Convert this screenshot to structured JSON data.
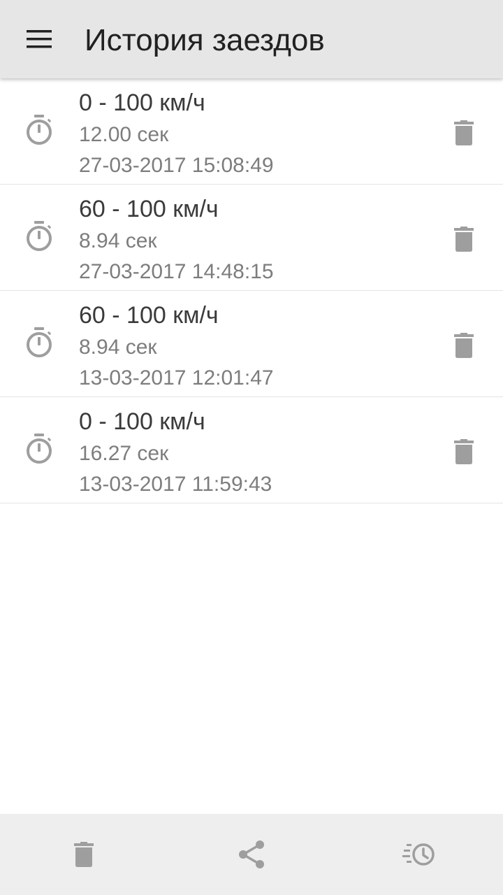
{
  "toolbar": {
    "menu_icon": "menu-icon",
    "title": "История заездов",
    "background": "#e6e6e6"
  },
  "runs": [
    {
      "title": "0 - 100 км/ч",
      "time": "12.00 сек",
      "date": "27-03-2017 15:08:49",
      "icon": "stopwatch-icon",
      "action_icon": "trash-icon"
    },
    {
      "title": "60 - 100 км/ч",
      "time": "8.94 сек",
      "date": "27-03-2017 14:48:15",
      "icon": "stopwatch-icon",
      "action_icon": "trash-icon"
    },
    {
      "title": "60 - 100 км/ч",
      "time": "8.94 сек",
      "date": "13-03-2017 12:01:47",
      "icon": "stopwatch-icon",
      "action_icon": "trash-icon"
    },
    {
      "title": "0 - 100 км/ч",
      "time": "16.27 сек",
      "date": "13-03-2017 11:59:43",
      "icon": "stopwatch-icon",
      "action_icon": "trash-icon"
    }
  ],
  "bottom_bar": {
    "buttons": [
      "trash-icon",
      "share-icon",
      "history-icon"
    ],
    "background": "#eeeeee"
  },
  "colors": {
    "icon_gray": "#9e9e9e",
    "title_text": "#3a3a3a",
    "secondary_text": "#7d7d7d"
  }
}
